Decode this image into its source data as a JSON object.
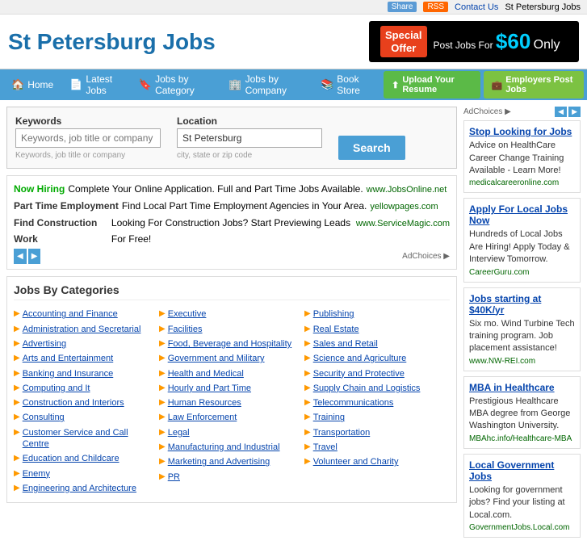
{
  "topbar": {
    "share_label": "Share",
    "rss_label": "RSS",
    "contact_label": "Contact Us",
    "location_label": "St Petersburg Jobs"
  },
  "header": {
    "site_title": "St Petersburg Jobs",
    "promo": {
      "special_offer": "Special\nOffer",
      "post_text": "Post Jobs For",
      "price": "$60",
      "only": "Only"
    }
  },
  "nav": {
    "items": [
      {
        "label": "Home",
        "icon": "🏠"
      },
      {
        "label": "Latest Jobs",
        "icon": "📄"
      },
      {
        "label": "Jobs by Category",
        "icon": "🔖"
      },
      {
        "label": "Jobs by Company",
        "icon": "🏢"
      },
      {
        "label": "Book Store",
        "icon": "📚"
      }
    ],
    "upload_label": "Upload Your Resume",
    "employers_label": "Employers Post Jobs"
  },
  "search": {
    "keywords_label": "Keywords",
    "keywords_placeholder": "Keywords, job title or company",
    "location_label": "Location",
    "location_value": "St Petersburg",
    "location_placeholder": "city, state or zip code",
    "search_button": "Search"
  },
  "ads": {
    "rows": [
      {
        "label": "Now Hiring",
        "text": "Complete Your Online Application. Full and Part Time Jobs Available.",
        "url": "www.JobsOnline.net"
      },
      {
        "label": "Part Time Employment",
        "text": "Find Local Part Time Employment Agencies in Your Area.",
        "url": "yellowpages.com"
      },
      {
        "label": "Find Construction Work",
        "text": "Looking For Construction Jobs? Start Previewing Leads For Free!",
        "url": "www.ServiceMagic.com"
      }
    ],
    "adchoices": "AdChoices"
  },
  "categories": {
    "heading": "Jobs By Categories",
    "columns": [
      [
        "Accounting and Finance",
        "Administration and Secretarial",
        "Advertising",
        "Arts and Entertainment",
        "Banking and Insurance",
        "Computing and It",
        "Construction and Interiors",
        "Consulting",
        "Customer Service and Call Centre",
        "Education and Childcare",
        "Enemy",
        "Engineering and Architecture"
      ],
      [
        "Executive",
        "Facilities",
        "Food, Beverage and Hospitality",
        "Government and Military",
        "Health and Medical",
        "Hourly and Part Time",
        "Human Resources",
        "Law Enforcement",
        "Legal",
        "Manufacturing and Industrial",
        "Marketing and Advertising",
        "PR"
      ],
      [
        "Publishing",
        "Real Estate",
        "Sales and Retail",
        "Science and Agriculture",
        "Security and Protective",
        "Supply Chain and Logistics",
        "Telecommunications",
        "Training",
        "Transportation",
        "Travel",
        "Volunteer and Charity"
      ]
    ]
  },
  "sidebar": {
    "adchoices_label": "AdChoices ▶",
    "ads": [
      {
        "title": "Stop Looking for Jobs",
        "body": "Advice on HealthCare Career Change Training Available - Learn More!",
        "url": "medicalcareeronline.com"
      },
      {
        "title": "Apply For Local Jobs Now",
        "body": "Hundreds of Local Jobs Are Hiring! Apply Today & Interview Tomorrow.",
        "url": "CareerGuru.com"
      },
      {
        "title": "Jobs starting at $40K/yr",
        "body": "Six mo. Wind Turbine Tech training program. Job placement assistance!",
        "url": "www.NW-REI.com"
      },
      {
        "title": "MBA in Healthcare",
        "body": "Prestigious Healthcare MBA degree from George Washington University.",
        "url": "MBAhc.info/Healthcare-MBA"
      },
      {
        "title": "Local Government Jobs",
        "body": "Looking for government jobs? Find your listing at Local.com.",
        "url": "GovernmentJobs.Local.com"
      }
    ]
  }
}
